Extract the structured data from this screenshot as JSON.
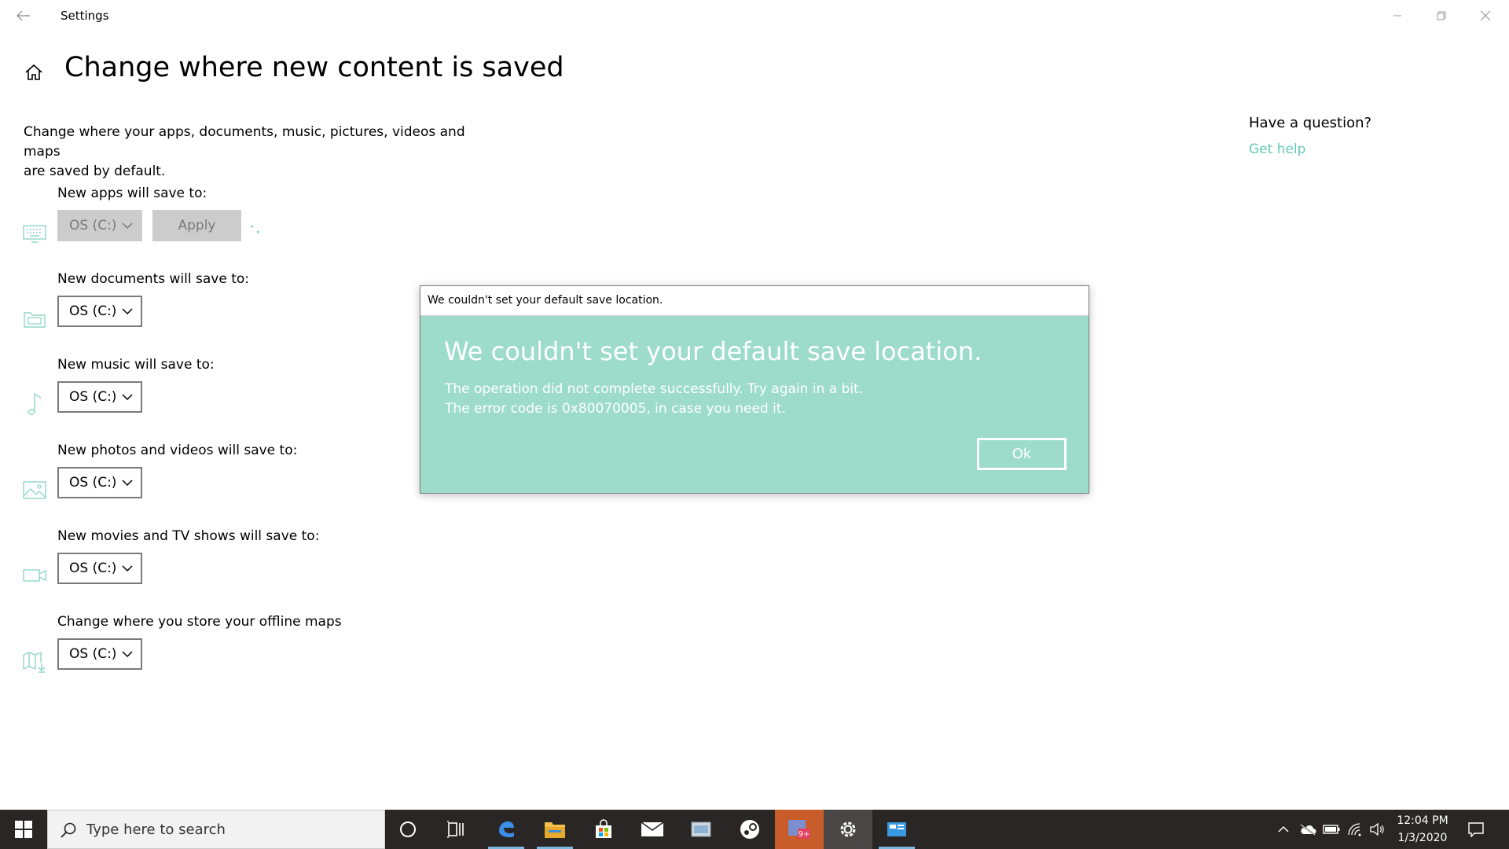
{
  "window": {
    "title": "Settings"
  },
  "page": {
    "title": "Change where new content is saved",
    "intro_line1": "Change where your apps, documents, music, pictures, videos and maps",
    "intro_line2": "are saved by default."
  },
  "groups": [
    {
      "label": "New apps will save to:",
      "value": "OS (C:)",
      "icon": "monitor-icon",
      "disabled": true,
      "apply_label": "Apply"
    },
    {
      "label": "New documents will save to:",
      "value": "OS (C:)",
      "icon": "folder-icon"
    },
    {
      "label": "New music will save to:",
      "value": "OS (C:)",
      "icon": "music-note-icon"
    },
    {
      "label": "New photos and videos will save to:",
      "value": "OS (C:)",
      "icon": "picture-icon"
    },
    {
      "label": "New movies and TV shows will save to:",
      "value": "OS (C:)",
      "icon": "video-camera-icon"
    },
    {
      "label": "Change where you store your offline maps",
      "value": "OS (C:)",
      "icon": "map-download-icon"
    }
  ],
  "help": {
    "title": "Have a question?",
    "link": "Get help"
  },
  "dialog": {
    "window_title": "We couldn't set your default save location.",
    "heading": "We couldn't set your default save location.",
    "message_line1": "The operation did not complete successfully. Try again in a bit.",
    "message_line2": "The error code is 0x80070005, in case you need it.",
    "ok_label": "Ok"
  },
  "taskbar": {
    "search_placeholder": "Type here to search",
    "badge": "9+",
    "time": "12:04 PM",
    "date": "1/3/2020"
  },
  "colors": {
    "accent": "#66c9b7",
    "dialog_bg": "#9ddcca",
    "taskbar_bg": "#2a2626"
  }
}
